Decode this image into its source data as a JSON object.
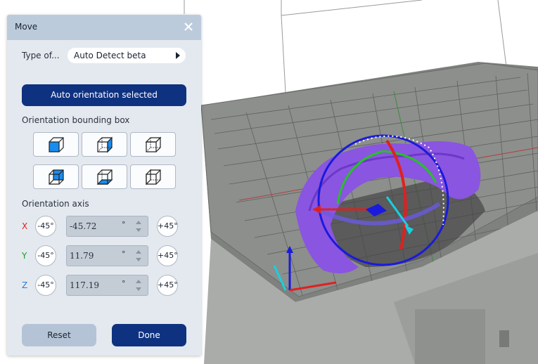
{
  "panel": {
    "title": "Move",
    "type_label": "Type of...",
    "type_value": "Auto Detect beta",
    "auto_orientation_label": "Auto orientation selected",
    "bounding_box_label": "Orientation bounding box",
    "axis_label": "Orientation axis",
    "axes": [
      {
        "name": "X",
        "color": "#e02020",
        "minus_label": "-45°",
        "plus_label": "+45°",
        "value": "-45.72",
        "unit": "°"
      },
      {
        "name": "Y",
        "color": "#1a9a2a",
        "minus_label": "-45°",
        "plus_label": "+45°",
        "value": "11.79",
        "unit": "°"
      },
      {
        "name": "Z",
        "color": "#2a7fd4",
        "minus_label": "-45°",
        "plus_label": "+45°",
        "value": "117.19",
        "unit": "°"
      }
    ],
    "reset_label": "Reset",
    "done_label": "Done"
  },
  "bounding_box_options": [
    {
      "icon": "cube-face-front-icon"
    },
    {
      "icon": "cube-face-right-icon"
    },
    {
      "icon": "cube-face-top-icon"
    },
    {
      "icon": "cube-face-back-icon"
    },
    {
      "icon": "cube-face-bottom-icon"
    },
    {
      "icon": "cube-face-left-icon"
    }
  ],
  "colors": {
    "accent": "#0f3280",
    "header": "#bccbdc",
    "panel_bg": "#e4e9ef",
    "model": "#8a55e0",
    "gizmo_ring": "#1a1adc"
  }
}
